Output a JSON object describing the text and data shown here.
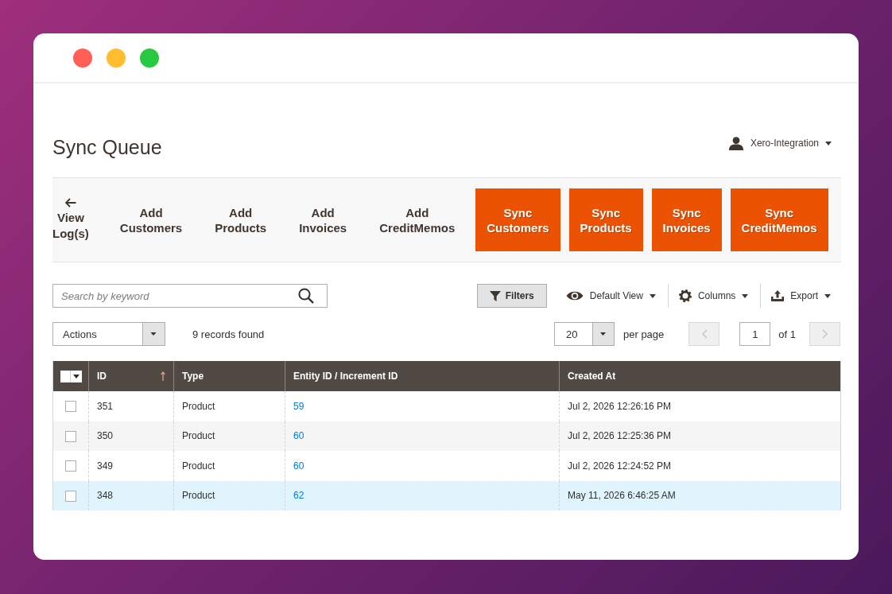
{
  "window": {
    "traffic_lights": [
      {
        "color": "#ff5f57"
      },
      {
        "color": "#febc2e"
      },
      {
        "color": "#28c840"
      }
    ]
  },
  "page_title": "Sync Queue",
  "user_menu": {
    "name": "Xero-Integration"
  },
  "action_buttons": [
    {
      "kind": "back",
      "label": "View Log(s)"
    },
    {
      "kind": "secondary",
      "label": "Add Customers"
    },
    {
      "kind": "secondary",
      "label": "Add Products"
    },
    {
      "kind": "secondary",
      "label": "Add Invoices"
    },
    {
      "kind": "secondary",
      "label": "Add CreditMemos"
    },
    {
      "kind": "primary",
      "label": "Sync Customers"
    },
    {
      "kind": "primary",
      "label": "Sync Products"
    },
    {
      "kind": "primary",
      "label": "Sync Invoices"
    },
    {
      "kind": "primary",
      "label": "Sync CreditMemos"
    }
  ],
  "grid": {
    "search": {
      "placeholder": "Search by keyword"
    },
    "filters_button": "Filters",
    "menus": [
      {
        "kind": "view",
        "label": "Default View"
      },
      {
        "kind": "columns",
        "label": "Columns"
      },
      {
        "kind": "export",
        "label": "Export"
      }
    ],
    "mass_actions": "Actions",
    "records_found": "9 records found",
    "pagination": {
      "page_size": "20",
      "per_page_label": "per page",
      "current_page": "1",
      "total_label": "of 1",
      "previous": {
        "disabled": true
      },
      "next": {
        "disabled": true
      }
    },
    "select_all": {
      "checked": false
    },
    "columns": [
      {
        "label": "ID",
        "sorted": true
      },
      {
        "label": "Type",
        "sorted": false
      },
      {
        "label": "Entity ID / Increment ID",
        "sorted": false
      },
      {
        "label": "Created At",
        "sorted": false
      }
    ],
    "rows": [
      {
        "checked": false,
        "highlighted": false,
        "id": "351",
        "type": "Product",
        "entity_id": "59",
        "created_at": "Jul 2, 2026 12:26:16 PM"
      },
      {
        "checked": false,
        "highlighted": false,
        "id": "350",
        "type": "Product",
        "entity_id": "60",
        "created_at": "Jul 2, 2026 12:25:36 PM"
      },
      {
        "checked": false,
        "highlighted": false,
        "id": "349",
        "type": "Product",
        "entity_id": "60",
        "created_at": "Jul 2, 2026 12:24:52 PM"
      },
      {
        "checked": false,
        "highlighted": true,
        "id": "348",
        "type": "Product",
        "entity_id": "62",
        "created_at": "May 11, 2026 6:46:25 AM"
      }
    ]
  }
}
